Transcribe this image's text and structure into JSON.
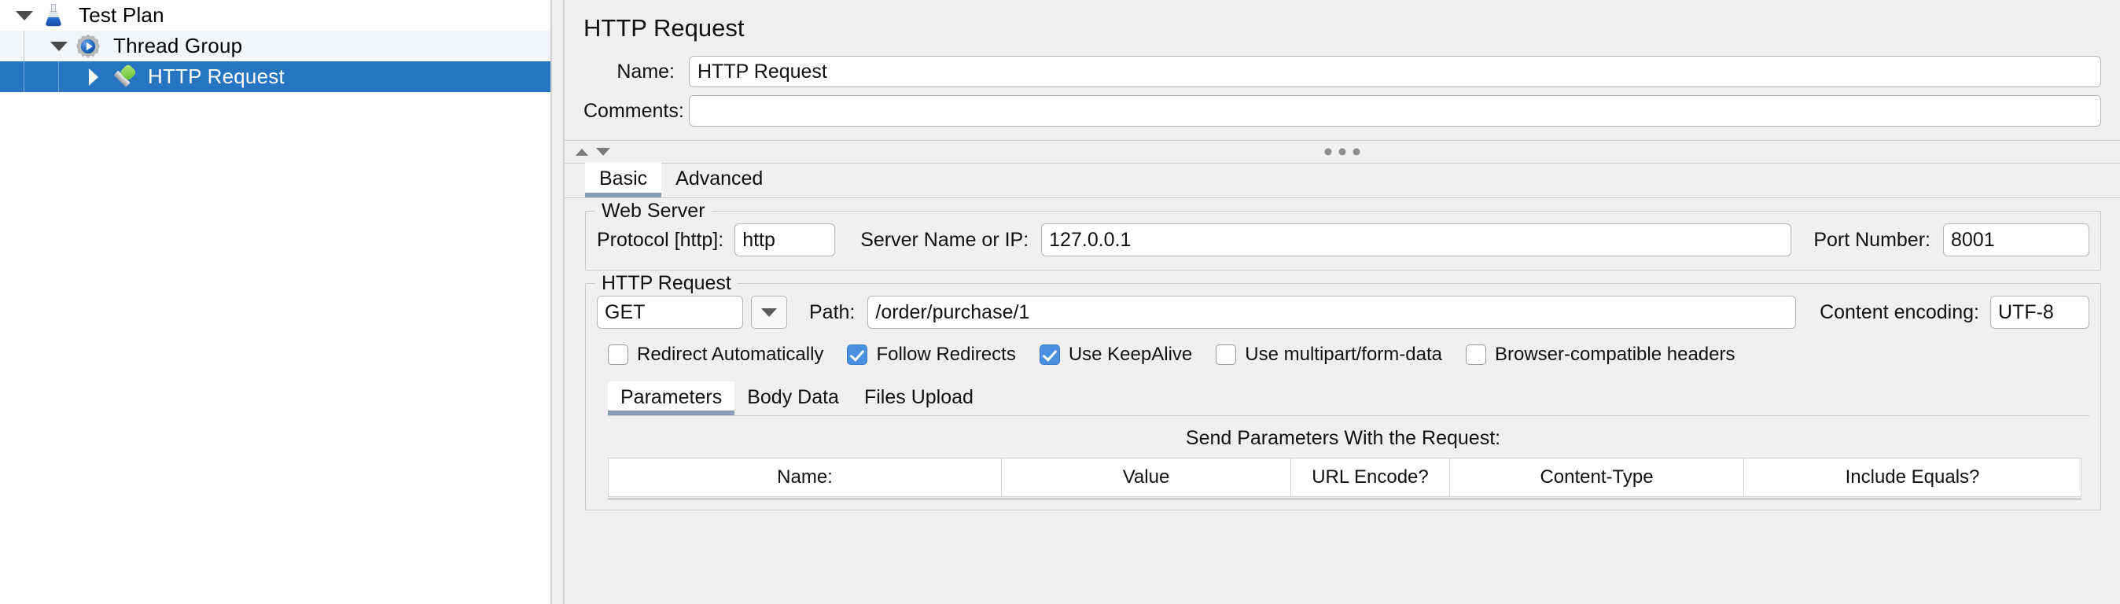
{
  "tree": {
    "nodes": [
      {
        "label": "Test Plan",
        "icon": "flask-icon",
        "twisty": "expanded",
        "depth": 0,
        "selected": false
      },
      {
        "label": "Thread Group",
        "icon": "gear-icon",
        "twisty": "expanded",
        "depth": 1,
        "selected": false
      },
      {
        "label": "HTTP Request",
        "icon": "pipette-icon",
        "twisty": "collapsed",
        "depth": 2,
        "selected": true
      }
    ]
  },
  "panel": {
    "title": "HTTP Request",
    "name_label": "Name:",
    "name_value": "HTTP Request",
    "comments_label": "Comments:",
    "comments_value": "",
    "comments_placeholder": ""
  },
  "main_tabs": [
    {
      "label": "Basic",
      "active": true
    },
    {
      "label": "Advanced",
      "active": false
    }
  ],
  "web_server": {
    "legend": "Web Server",
    "protocol_label": "Protocol [http]:",
    "protocol_value": "http",
    "server_label": "Server Name or IP:",
    "server_value": "127.0.0.1",
    "port_label": "Port Number:",
    "port_value": "8001"
  },
  "http_request": {
    "legend": "HTTP Request",
    "method_value": "GET",
    "path_label": "Path:",
    "path_value": "/order/purchase/1",
    "content_encoding_label": "Content encoding:",
    "content_encoding_value": "UTF-8",
    "checkboxes": [
      {
        "label": "Redirect Automatically",
        "checked": false
      },
      {
        "label": "Follow Redirects",
        "checked": true
      },
      {
        "label": "Use KeepAlive",
        "checked": true
      },
      {
        "label": "Use multipart/form-data",
        "checked": false
      },
      {
        "label": "Browser-compatible headers",
        "checked": false
      }
    ]
  },
  "sub_tabs": [
    {
      "label": "Parameters",
      "active": true
    },
    {
      "label": "Body Data",
      "active": false
    },
    {
      "label": "Files Upload",
      "active": false
    }
  ],
  "params": {
    "title": "Send Parameters With the Request:",
    "columns": [
      "Name:",
      "Value",
      "URL Encode?",
      "Content-Type",
      "Include Equals?"
    ],
    "rows": []
  },
  "colors": {
    "selection": "#2575c0",
    "annotation": "#e8492a",
    "tab_underline": "#8a9cb5",
    "checkbox_on": "#4a8fe0"
  }
}
